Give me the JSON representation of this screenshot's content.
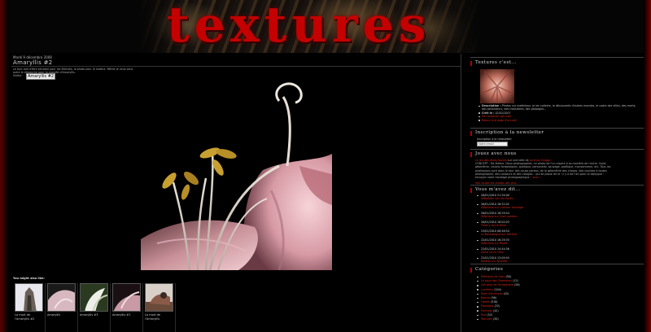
{
  "header": {
    "logo_text": "textures"
  },
  "post": {
    "date": "Mardi 9 décembre 2008",
    "title": "Amaryllis #2",
    "body": "Le tout doit d'être sensible pour les fétiches, la photo pour le moteur. Même je veux sans autre le dimanche pour la coquille d'Amaryllis.",
    "tag_label": "Vidéo:",
    "tag_box": "Amaryllis #2",
    "also_label": "You might also like:",
    "thumbs": [
      {
        "caption": "La mort de l'Amaryllis #2",
        "icon": "building-thumb"
      },
      {
        "caption": "Amaryllis",
        "icon": "flower-thumb"
      },
      {
        "caption": "Amaryllis #3",
        "icon": "flower-thumb"
      },
      {
        "caption": "Amaryllis #1",
        "icon": "flower-thumb"
      },
      {
        "caption": "La mort de l'Amaryllis",
        "icon": "still-life-thumb"
      }
    ]
  },
  "sidebar": {
    "textures_title": "Textures c'est...",
    "textures_items": [
      {
        "label": "Description :",
        "text": "Photos sur matériaux, je les collecte, la découverte d'autres mondes, le cadre des villes, des morts, des pesanteurs, des transitions, des passages..."
      },
      {
        "label": "Créé le :",
        "text": "02/02/2007"
      },
      {
        "label": "",
        "text": "Me contacter par mail",
        "red": true
      },
      {
        "label": "",
        "text": "Retour à la page d'accueil",
        "red": true
      }
    ],
    "newsletter_title": "Inscription à la newsletter",
    "newsletter_label": "Inscription à la newsletter",
    "newsletter_placeholder": "Votre email",
    "game_title": "Jouez avec nous",
    "game_link_1": "Le jeu des rêves fauves",
    "game_mid": " sur une idée de ",
    "game_link_2": "Lorenzo Grogan",
    "game_text": "CONCEPT : De thème. Deux photographes. Le photo de l'un inspire à sa manière de l'autre. Sujet, géométrie, visions fantastiques, politique, personelle, sauvage, poétique, monochrome, etc. Tous les professions sont dans le tour des coups perdus, de la géométrie des choses, des courbes à toutes photographie, des contours et des visages... qui se passe de là : il y a de l'art pour le diptyque : envoyez votre montage photographique",
    "game_more": "« plus »",
    "game_footer": "Voir toutes les photos des jeux",
    "comments_title": "Vous m'avez dit...",
    "comments": [
      {
        "ts": "26/01/2010 21:34:00",
        "who": "Sébastien sur Les Pavés"
      },
      {
        "ts": "26/01/2010 16:31:02",
        "who": "Stéphane sur L'Amour Sauvage"
      },
      {
        "ts": "26/01/2010 16:29:44",
        "who": "Stéphane sur Quel nombre"
      },
      {
        "ts": "26/01/2010 16:02:03",
        "who": "Thierry sur le dîner"
      },
      {
        "ts": "23/01/2010 08:48:54",
        "who": "Le Bouledogue sur Hérésie"
      },
      {
        "ts": "22/01/2010 16:29:35",
        "who": "Stéphane sur Rosée"
      },
      {
        "ts": "22/01/2010 14:44:56",
        "who": "Sonia sur le rêve"
      },
      {
        "ts": "22/01/2010 13:09:45",
        "who": "Nicolas sur Tenerife"
      }
    ],
    "categories_title": "Catégories",
    "categories": [
      {
        "name": "Éléments de l'eau",
        "count": "(50)"
      },
      {
        "name": "Le pays des Chamanes",
        "count": "(12)"
      },
      {
        "name": "Les pays de l'imaginaire",
        "count": "(26)"
      },
      {
        "name": "Lumières",
        "count": "(104)"
      },
      {
        "name": "Murs d'écritures",
        "count": "(42)"
      },
      {
        "name": "Nature",
        "count": "(96)"
      },
      {
        "name": "Objets",
        "count": "(318)"
      },
      {
        "name": "Paysages",
        "count": "(22)"
      },
      {
        "name": "Portraits",
        "count": "(42)"
      },
      {
        "name": "Rue",
        "count": "(52)"
      },
      {
        "name": "Textures",
        "count": "(30)"
      }
    ]
  }
}
